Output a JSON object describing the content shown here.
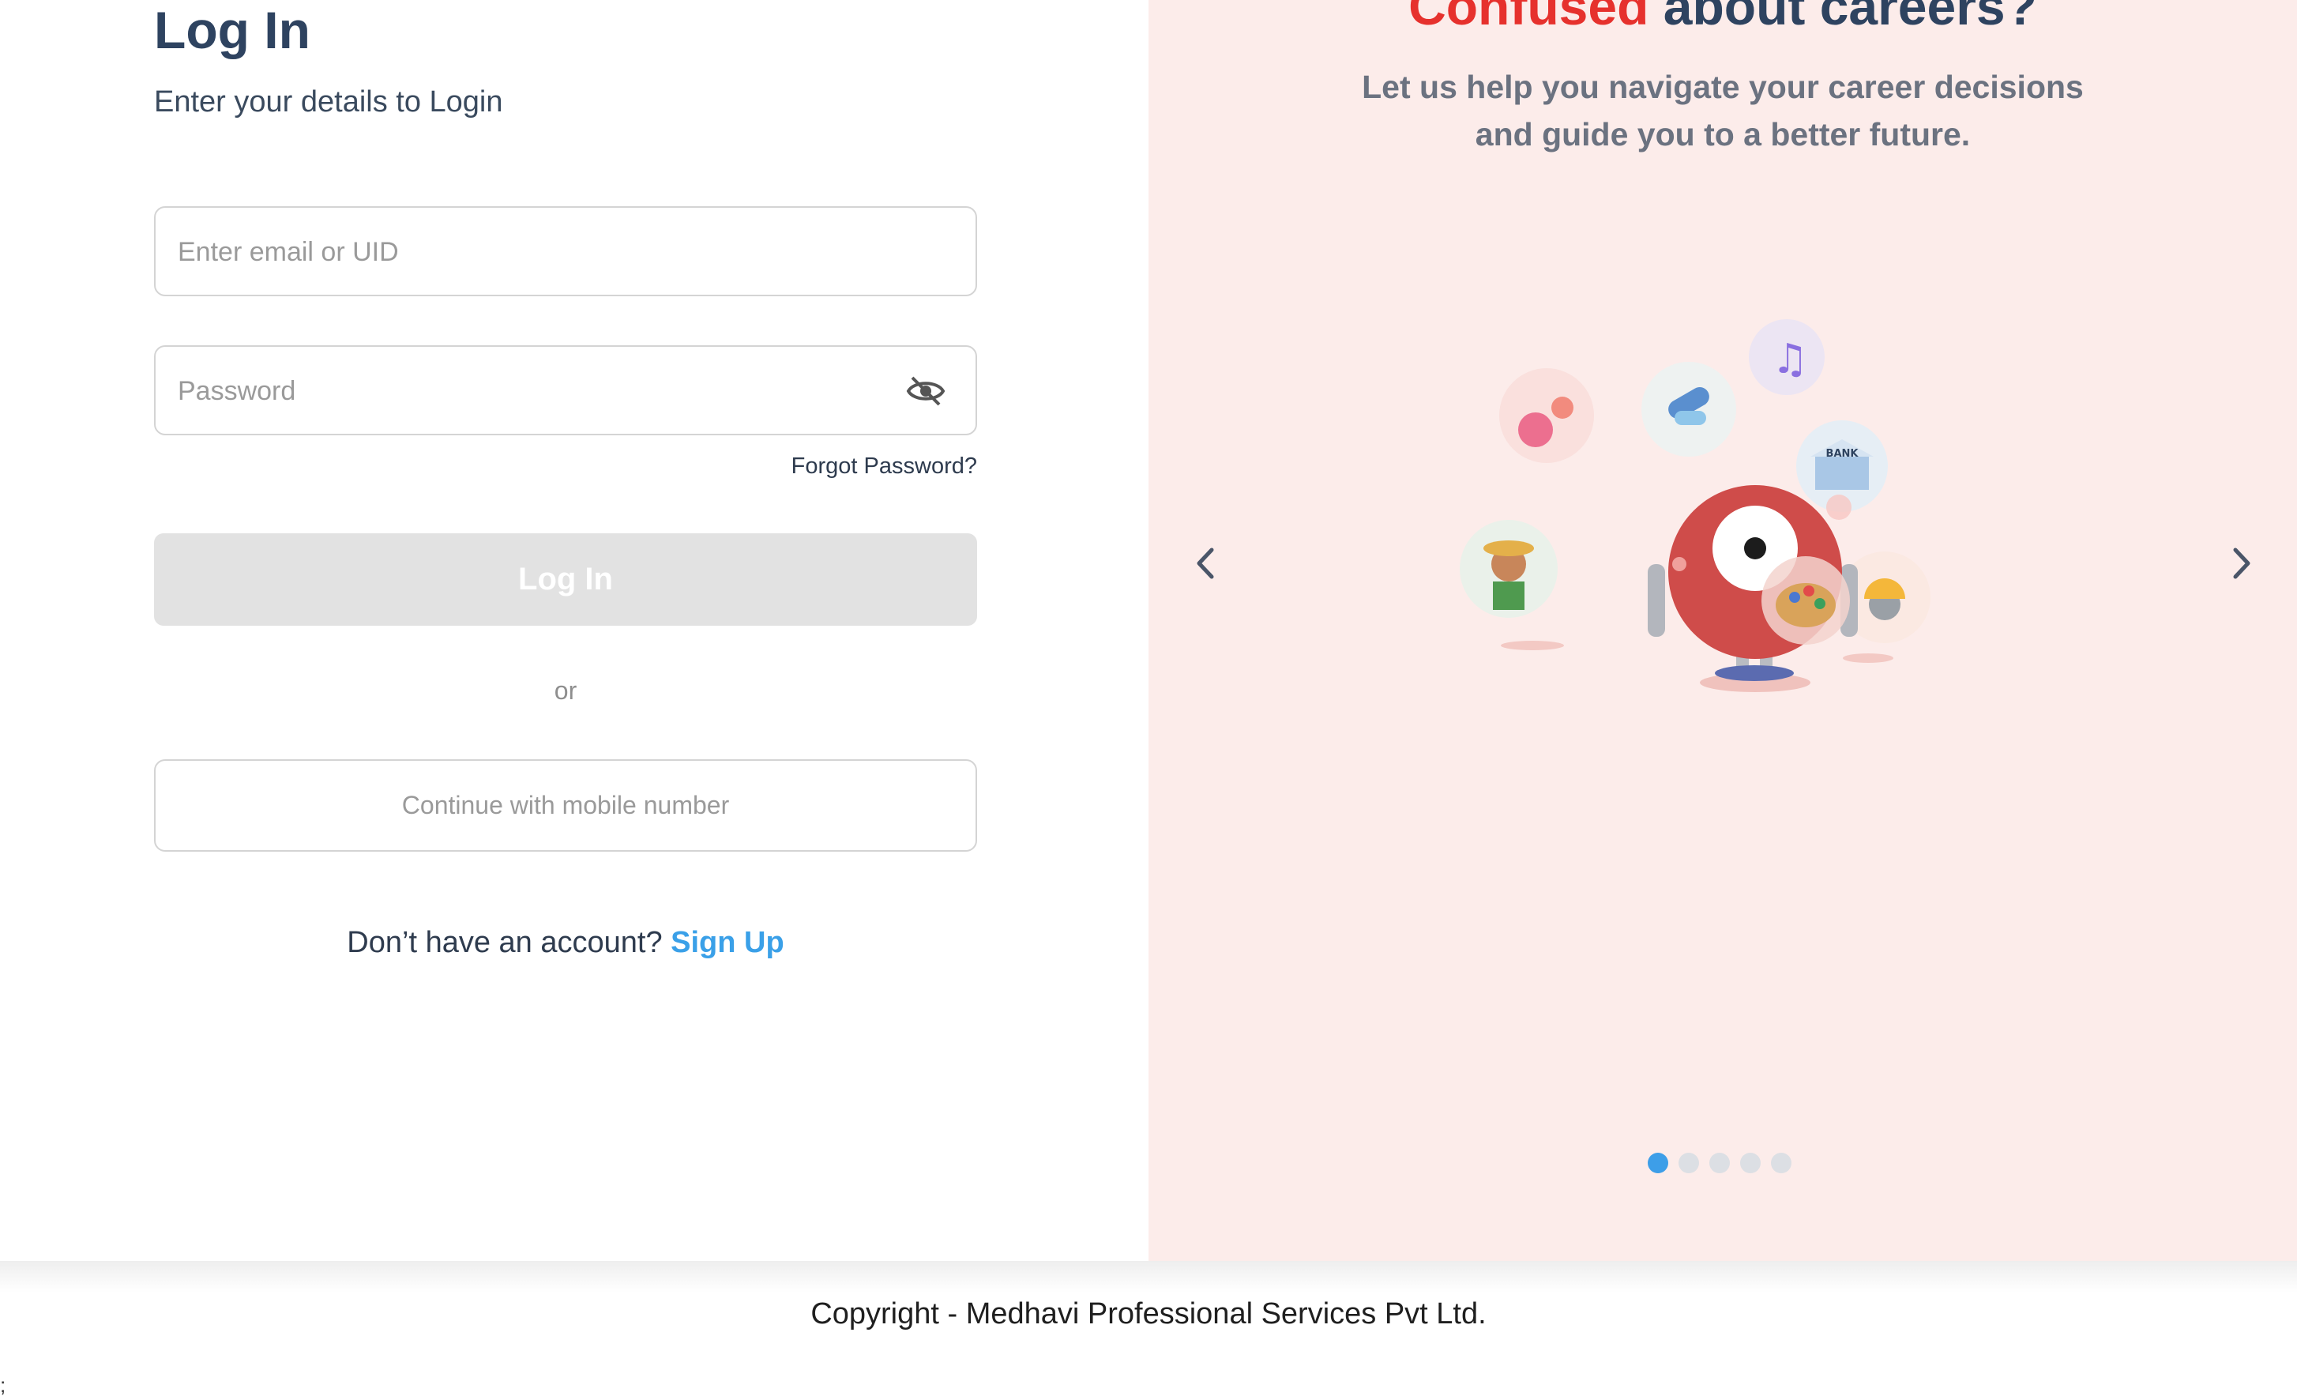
{
  "login": {
    "title": "Log In",
    "subtitle": "Enter your details to Login",
    "email_placeholder": "Enter email or UID",
    "password_placeholder": "Password",
    "forgot_label": "Forgot Password?",
    "login_button": "Log In",
    "or_label": "or",
    "mobile_button": "Continue with mobile number",
    "no_account_text": "Don’t have an account?",
    "signup_link": "Sign Up"
  },
  "hero": {
    "title_accent": "Confused",
    "title_rest": "about careers?",
    "description_line1": "Let us help you navigate your career decisions",
    "description_line2": "and guide you to a better future.",
    "bank_sign": "BANK",
    "slides_total": 5,
    "active_slide": 1
  },
  "footer": {
    "copyright": "Copyright - Medhavi Professional Services Pvt Ltd.",
    "stray_char": ";"
  },
  "colors": {
    "accent_red": "#e6312d",
    "heading_navy": "#2e4360",
    "link_blue": "#3aa0e8",
    "panel_pink": "#fcecea",
    "disabled_gray": "#e2e2e2"
  },
  "icons": [
    "eye-off-icon",
    "chevron-left-icon",
    "chevron-right-icon"
  ]
}
